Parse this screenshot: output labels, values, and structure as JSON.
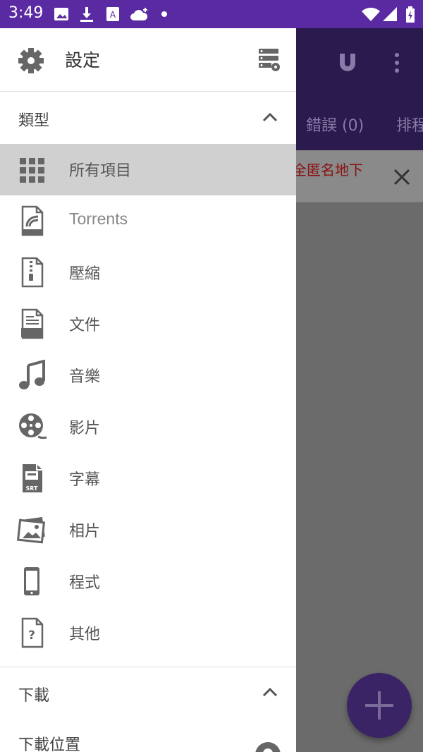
{
  "status_bar": {
    "time": "3:49"
  },
  "background_app": {
    "tabs": [
      "錯誤 (0)",
      "排程"
    ],
    "banner_text": "全匿名地下"
  },
  "drawer": {
    "header_title": "設定",
    "section_types": "類型",
    "items": [
      {
        "label": "所有項目",
        "icon": "grid-icon",
        "selected": true
      },
      {
        "label": "Torrents",
        "icon": "torrent-file-icon"
      },
      {
        "label": "壓縮",
        "icon": "zip-file-icon"
      },
      {
        "label": "文件",
        "icon": "doc-file-icon"
      },
      {
        "label": "音樂",
        "icon": "music-note-icon"
      },
      {
        "label": "影片",
        "icon": "film-reel-icon"
      },
      {
        "label": "字幕",
        "icon": "srt-file-icon"
      },
      {
        "label": "相片",
        "icon": "photos-icon"
      },
      {
        "label": "程式",
        "icon": "phone-icon"
      },
      {
        "label": "其他",
        "icon": "unknown-file-icon"
      }
    ],
    "section_downloads": "下載",
    "download_location": "下載位置"
  },
  "colors": {
    "status_bar": "#5a2aa3",
    "app_header": "#2a1a4d",
    "fab": "#3a2466",
    "selected_row": "#d0d0d0"
  }
}
